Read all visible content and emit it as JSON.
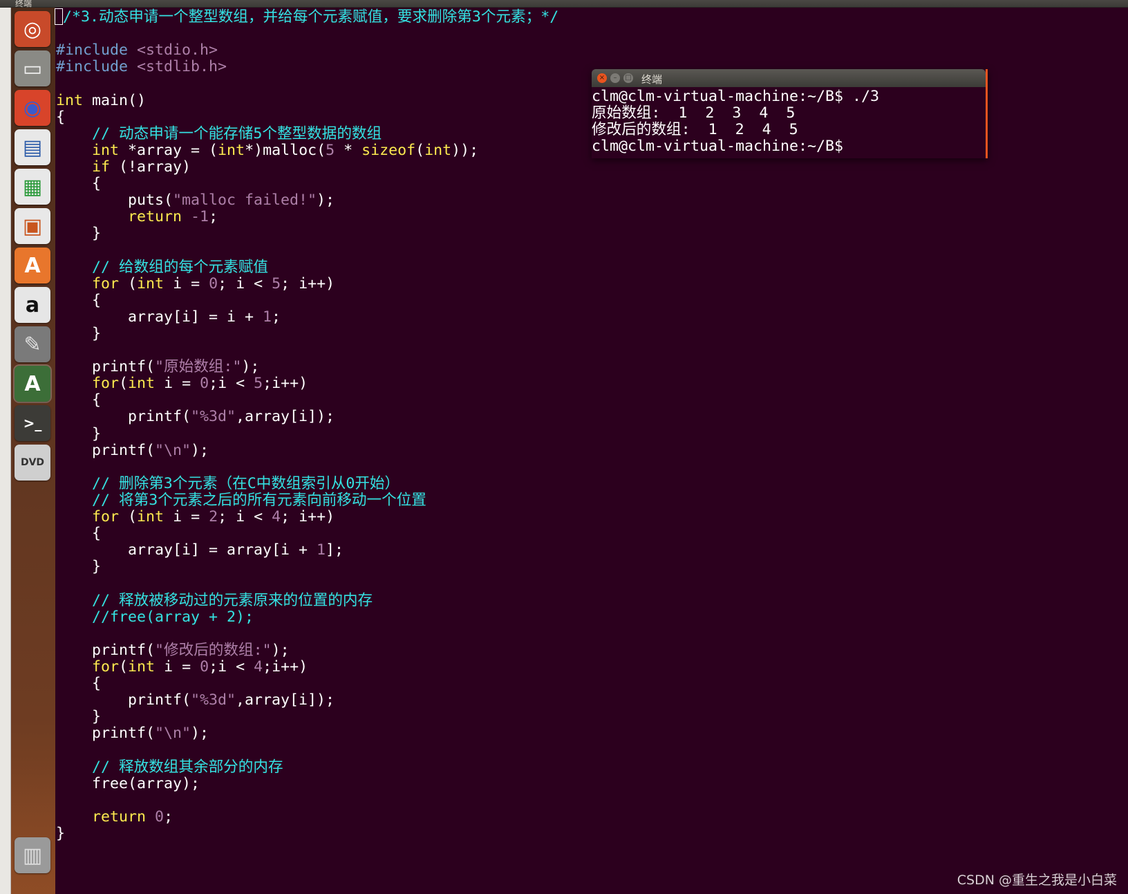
{
  "window": {
    "title": "终端"
  },
  "launcher": {
    "items": [
      {
        "name": "dash-home-icon",
        "glyph": "◎",
        "bg": "#c84a2a",
        "fg": "#ffffff"
      },
      {
        "name": "files-icon",
        "glyph": "▭",
        "bg": "#8a8a85",
        "fg": "#eeeeee"
      },
      {
        "name": "firefox-icon",
        "glyph": "◉",
        "bg": "#d8442a",
        "fg": "#3b5bcc"
      },
      {
        "name": "libreoffice-writer-icon",
        "glyph": "▤",
        "bg": "#e8e8e8",
        "fg": "#2a5aa8"
      },
      {
        "name": "libreoffice-calc-icon",
        "glyph": "▦",
        "bg": "#e8e8e8",
        "fg": "#2a9a3a"
      },
      {
        "name": "libreoffice-impress-icon",
        "glyph": "▣",
        "bg": "#e8e8e8",
        "fg": "#c8551e"
      },
      {
        "name": "software-center-icon",
        "glyph": "A",
        "bg": "#e8762c",
        "fg": "#ffffff"
      },
      {
        "name": "amazon-icon",
        "glyph": "a",
        "bg": "#e6e6e6",
        "fg": "#111111"
      },
      {
        "name": "system-settings-icon",
        "glyph": "✎",
        "bg": "#7a7a7a",
        "fg": "#e0e0e0"
      },
      {
        "name": "software-updater-icon",
        "glyph": "A",
        "bg": "#3c6e38",
        "fg": "#ffffff"
      },
      {
        "name": "terminal-icon",
        "glyph": ">_",
        "bg": "#3c3b37",
        "fg": "#ffffff"
      },
      {
        "name": "dvd-icon",
        "glyph": "DVD",
        "bg": "#cfcfcf",
        "fg": "#333333"
      },
      {
        "name": "trash-icon",
        "glyph": "▥",
        "bg": "#9a9a9a",
        "fg": "#dddddd"
      }
    ]
  },
  "editor": {
    "lines": [
      {
        "t": "/*3.动态申请一个整型数组，并给每个元素赋值，要求删除第3个元素；*/",
        "cursor": true
      },
      {
        "t": ""
      },
      {
        "t": "#include <stdio.h>"
      },
      {
        "t": "#include <stdlib.h>"
      },
      {
        "t": ""
      },
      {
        "t": "int main()"
      },
      {
        "t": "{"
      },
      {
        "t": "    // 动态申请一个能存储5个整型数据的数组"
      },
      {
        "t": "    int *array = (int*)malloc(5 * sizeof(int));"
      },
      {
        "t": "    if (!array)"
      },
      {
        "t": "    {"
      },
      {
        "t": "        puts(\"malloc failed!\");"
      },
      {
        "t": "        return -1;"
      },
      {
        "t": "    }"
      },
      {
        "t": ""
      },
      {
        "t": "    // 给数组的每个元素赋值"
      },
      {
        "t": "    for (int i = 0; i < 5; i++)"
      },
      {
        "t": "    {"
      },
      {
        "t": "        array[i] = i + 1;"
      },
      {
        "t": "    }"
      },
      {
        "t": ""
      },
      {
        "t": "    printf(\"原始数组:\");"
      },
      {
        "t": "    for(int i = 0;i < 5;i++)"
      },
      {
        "t": "    {"
      },
      {
        "t": "        printf(\"%3d\",array[i]);"
      },
      {
        "t": "    }"
      },
      {
        "t": "    printf(\"\\n\");"
      },
      {
        "t": ""
      },
      {
        "t": "    // 删除第3个元素（在C中数组索引从0开始）"
      },
      {
        "t": "    // 将第3个元素之后的所有元素向前移动一个位置"
      },
      {
        "t": "    for (int i = 2; i < 4; i++)"
      },
      {
        "t": "    {"
      },
      {
        "t": "        array[i] = array[i + 1];"
      },
      {
        "t": "    }"
      },
      {
        "t": ""
      },
      {
        "t": "    // 释放被移动过的元素原来的位置的内存"
      },
      {
        "t": "    //free(array + 2);"
      },
      {
        "t": ""
      },
      {
        "t": "    printf(\"修改后的数组:\");"
      },
      {
        "t": "    for(int i = 0;i < 4;i++)"
      },
      {
        "t": "    {"
      },
      {
        "t": "        printf(\"%3d\",array[i]);"
      },
      {
        "t": "    }"
      },
      {
        "t": "    printf(\"\\n\");"
      },
      {
        "t": ""
      },
      {
        "t": "    // 释放数组其余部分的内存"
      },
      {
        "t": "    free(array);"
      },
      {
        "t": ""
      },
      {
        "t": "    return 0;"
      },
      {
        "t": "}"
      }
    ]
  },
  "terminal": {
    "title": "终端",
    "lines": [
      "clm@clm-virtual-machine:~/B$ ./3",
      "原始数组:  1  2  3  4  5",
      "修改后的数组:  1  2  4  5",
      "clm@clm-virtual-machine:~/B$"
    ]
  },
  "watermark": "CSDN @重生之我是小白菜",
  "colors": {
    "background": "#2c001e",
    "comment": "#34e2e2",
    "preprocessor": "#729fcf",
    "keyword": "#fce94f",
    "constant": "#ad7fa8",
    "text": "#ffffff",
    "accent": "#e9541f"
  }
}
